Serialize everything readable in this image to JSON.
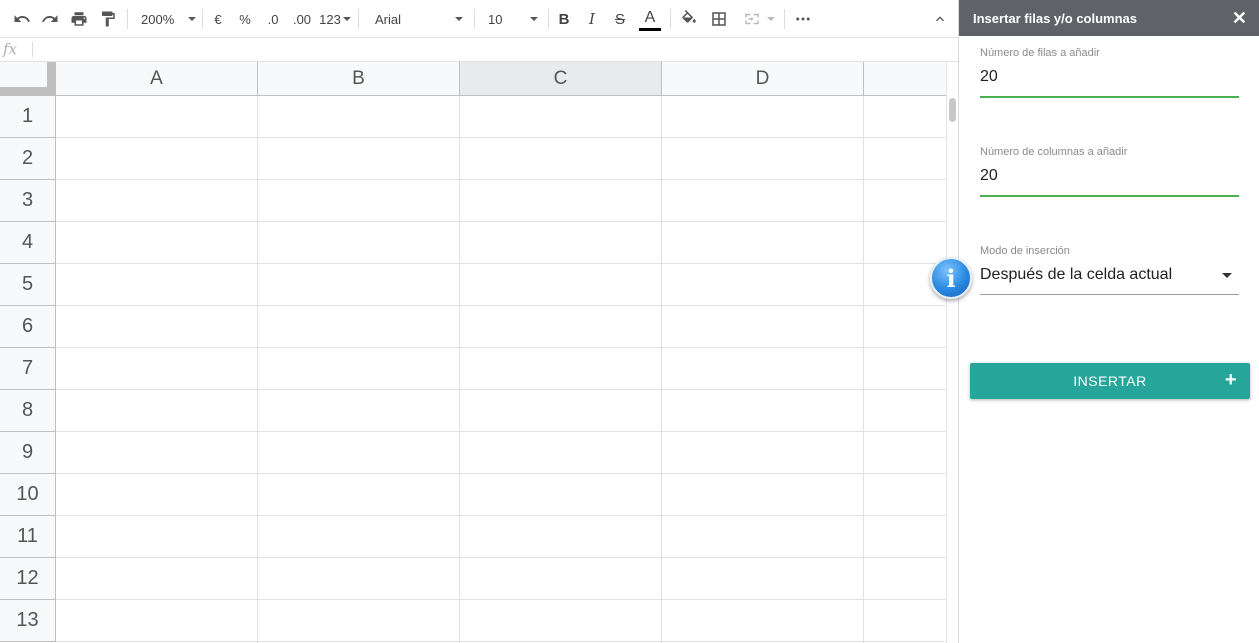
{
  "toolbar": {
    "zoom": "200%",
    "currency": "€",
    "percent": "%",
    "decimal_decrease": ".0",
    "decimal_increase": ".00",
    "number_format": "123",
    "font": "Arial",
    "font_size": "10",
    "bold": "B",
    "italic": "I",
    "strike": "S",
    "text_color_glyph": "A",
    "text_color": "#000000",
    "icons": [
      "undo-icon",
      "redo-icon",
      "print-icon",
      "paint-format-icon",
      "fill-color-icon",
      "borders-icon",
      "merge-cells-icon",
      "more-icon",
      "collapse-icon"
    ]
  },
  "formula_bar": {
    "fx": "fx",
    "value": ""
  },
  "sheet": {
    "columns": [
      "A",
      "B",
      "C",
      "D"
    ],
    "selected_column": "C",
    "rows": [
      "1",
      "2",
      "3",
      "4",
      "5",
      "6",
      "7",
      "8",
      "9",
      "10",
      "11",
      "12",
      "13"
    ]
  },
  "panel": {
    "title": "Insertar filas y/o columnas",
    "close": "✕",
    "rows_label": "Número de filas a añadir",
    "rows_value": "20",
    "cols_label": "Número de columnas a añadir",
    "cols_value": "20",
    "mode_label": "Modo de inserción",
    "mode_value": "Después de la celda actual",
    "insert_button": "INSERTAR",
    "insert_plus": "+",
    "accent_color": "#26a69a",
    "field_ok_color": "#4caf50"
  },
  "info_badge": {
    "glyph": "i"
  }
}
